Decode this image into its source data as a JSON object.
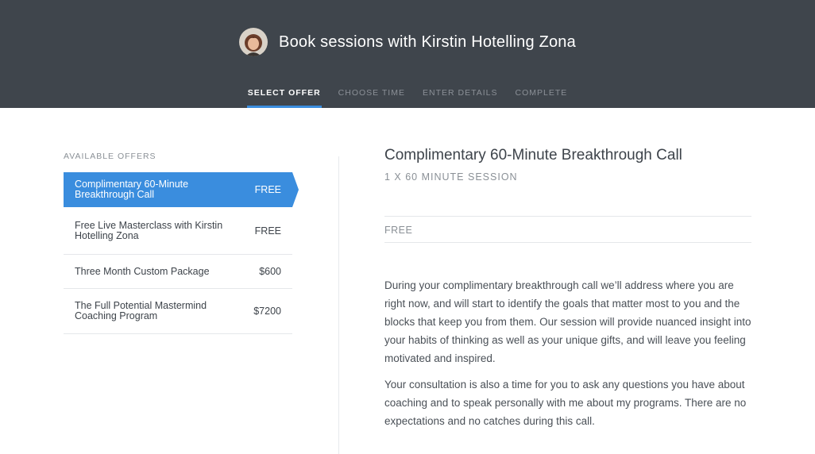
{
  "header": {
    "title": "Book sessions with Kirstin Hotelling Zona",
    "steps": [
      {
        "label": "SELECT OFFER",
        "active": true
      },
      {
        "label": "CHOOSE TIME",
        "active": false
      },
      {
        "label": "ENTER DETAILS",
        "active": false
      },
      {
        "label": "COMPLETE",
        "active": false
      }
    ]
  },
  "offers": {
    "heading": "AVAILABLE OFFERS",
    "items": [
      {
        "name": "Complimentary 60-Minute Breakthrough Call",
        "price": "FREE",
        "selected": true
      },
      {
        "name": "Free Live Masterclass with Kirstin Hotelling Zona",
        "price": "FREE",
        "selected": false
      },
      {
        "name": "Three Month Custom Package",
        "price": "$600",
        "selected": false
      },
      {
        "name": "The Full Potential Mastermind Coaching Program",
        "price": "$7200",
        "selected": false
      }
    ]
  },
  "detail": {
    "title": "Complimentary 60-Minute Breakthrough Call",
    "subtitle": "1 X 60 MINUTE SESSION",
    "price": "FREE",
    "paragraphs": [
      "During your complimentary breakthrough call we’ll address where you are right now, and will start to identify the goals that matter most to you and the blocks that keep you from them. Our session will provide nuanced insight into your habits of thinking as well as your unique gifts, and will leave you feeling motivated and inspired.",
      "Your consultation is also a time for you to ask any questions you have about coaching and to speak personally with me about my programs. There are no expectations and no catches during this call."
    ]
  },
  "colors": {
    "header_bg": "#3f454c",
    "accent": "#3a8dde"
  }
}
